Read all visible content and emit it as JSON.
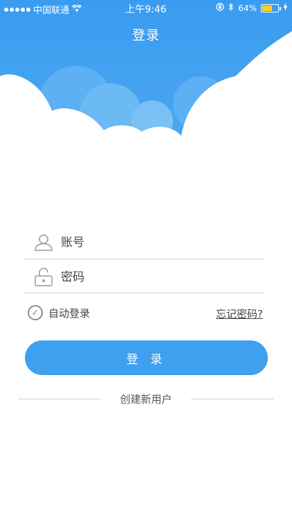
{
  "status_bar": {
    "carrier": "中国联通",
    "time": "上午9:46",
    "battery_percent": "64%",
    "battery_level": 0.64,
    "signal_icon": "signal-dots-icon",
    "wifi_icon": "wifi-icon",
    "rotation_lock_icon": "rotation-lock-icon",
    "bluetooth_icon": "bluetooth-icon",
    "charging_icon": "charging-bolt-icon"
  },
  "header": {
    "title": "登录",
    "background_color": "#3a9bf0"
  },
  "form": {
    "account_placeholder": "账号",
    "password_placeholder": "密码",
    "account_icon": "user-icon",
    "password_icon": "lock-icon",
    "remember_label": "自动登录",
    "remember_checked": true,
    "forgot_label": "忘记密码?",
    "login_button": "登 录",
    "accent_color": "#3ea0ef"
  },
  "footer": {
    "create_account": "创建新用户"
  }
}
